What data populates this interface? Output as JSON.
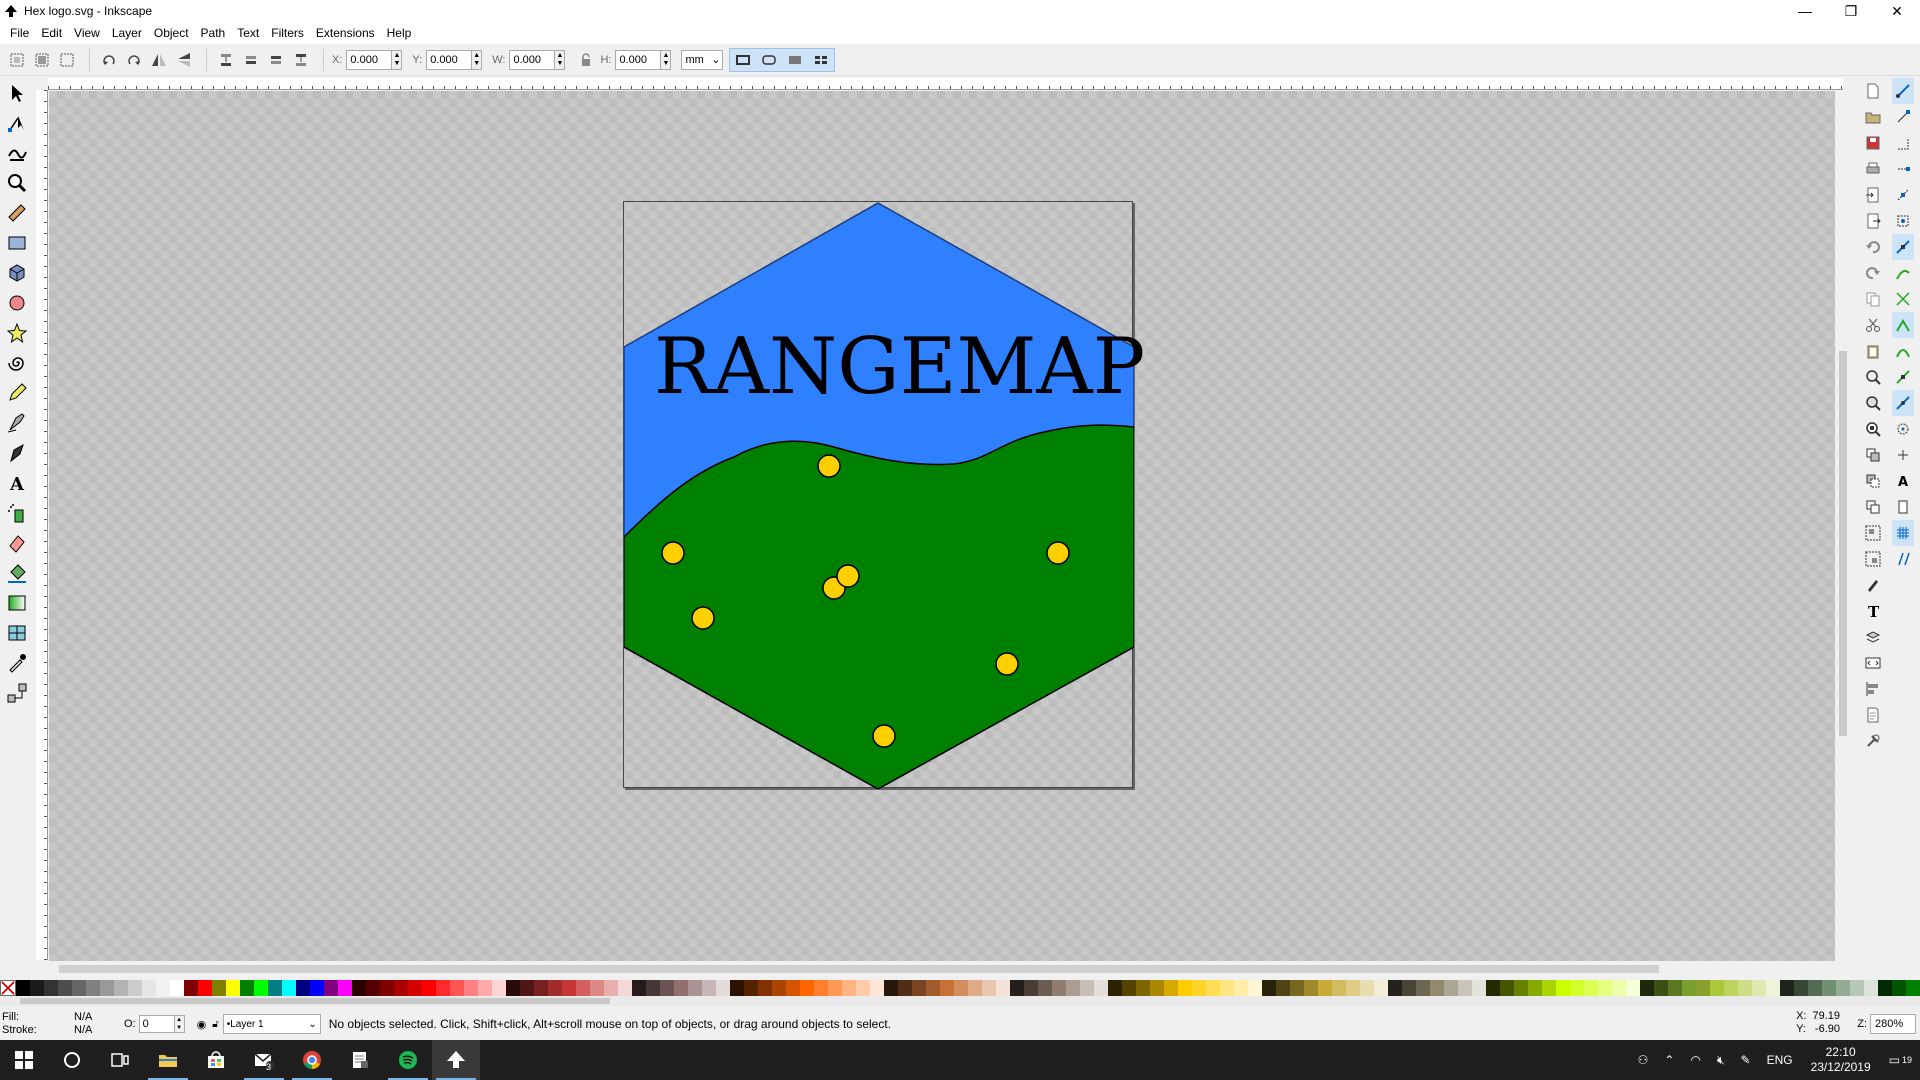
{
  "window": {
    "title": "Hex logo.svg - Inkscape",
    "minimize": "—",
    "maximize": "❐",
    "close": "✕"
  },
  "menu": [
    "File",
    "Edit",
    "View",
    "Layer",
    "Object",
    "Path",
    "Text",
    "Filters",
    "Extensions",
    "Help"
  ],
  "controls": {
    "x_label": "X:",
    "x_value": "0.000",
    "y_label": "Y:",
    "y_value": "0.000",
    "w_label": "W:",
    "w_value": "0.000",
    "h_label": "H:",
    "h_value": "0.000",
    "unit": "mm"
  },
  "canvas": {
    "logo_text": "RANGEMAP",
    "sky_color": "#2f80ff",
    "grass_color": "#008000",
    "dot_color": "#ffd000"
  },
  "palette": [
    "#000000",
    "#1a1a1a",
    "#333333",
    "#4d4d4d",
    "#666666",
    "#808080",
    "#999999",
    "#b3b3b3",
    "#cccccc",
    "#e6e6e6",
    "#f2f2f2",
    "#ffffff",
    "#800000",
    "#ff0000",
    "#808000",
    "#ffff00",
    "#008000",
    "#00ff00",
    "#008080",
    "#00ffff",
    "#000080",
    "#0000ff",
    "#800080",
    "#ff00ff",
    "#2b0000",
    "#550000",
    "#800000",
    "#aa0000",
    "#d40000",
    "#ff0000",
    "#ff2a2a",
    "#ff5555",
    "#ff8080",
    "#ffaaaa",
    "#ffd5d5",
    "#280b0b",
    "#501616",
    "#782121",
    "#a02c2c",
    "#c83737",
    "#d35f5f",
    "#de8787",
    "#e9afaf",
    "#f4d7d7",
    "#241c1c",
    "#483737",
    "#6c5353",
    "#916f6f",
    "#ac9393",
    "#c8b7b7",
    "#e3dbdb",
    "#2b1100",
    "#552200",
    "#803300",
    "#aa4400",
    "#d45500",
    "#ff6600",
    "#ff7f2a",
    "#ff9955",
    "#ffb380",
    "#ffccaa",
    "#ffe6d5",
    "#28170b",
    "#502d16",
    "#784421",
    "#a05a2c",
    "#c87137",
    "#d38d5f",
    "#deaa87",
    "#e9c6af",
    "#f4e3d7",
    "#241f1c",
    "#483e37",
    "#6c5d53",
    "#917c6f",
    "#ac9d93",
    "#c8beb7",
    "#e3dedb",
    "#2b2200",
    "#554400",
    "#806600",
    "#aa8800",
    "#d4aa00",
    "#ffcc00",
    "#ffd42a",
    "#ffdd55",
    "#ffe680",
    "#ffeeaa",
    "#fff6d5",
    "#28220b",
    "#504416",
    "#786721",
    "#a0892c",
    "#c8ab37",
    "#d3bc5f",
    "#decd87",
    "#e9ddaf",
    "#f4eed7",
    "#24221c",
    "#484537",
    "#6c6753",
    "#918a6f",
    "#aca793",
    "#c8c4b7",
    "#e3e2db",
    "#222b00",
    "#445500",
    "#668000",
    "#88aa00",
    "#aad400",
    "#ccff00",
    "#d4ff2a",
    "#ddff55",
    "#e5ff80",
    "#eeffaa",
    "#f6ffd5",
    "#1e280b",
    "#3c5016",
    "#597821",
    "#78a02c",
    "#89a02c",
    "#abc837",
    "#bcd35f",
    "#cdde87",
    "#dde9af",
    "#eef4d7",
    "#1c241c",
    "#374837",
    "#536c53",
    "#6f916f",
    "#93ac93",
    "#b7c8b7",
    "#dbe3db",
    "#002b00",
    "#005500",
    "#008000"
  ],
  "status": {
    "fill_label": "Fill:",
    "fill_value": "N/A",
    "stroke_label": "Stroke:",
    "stroke_value": "N/A",
    "opacity_label": "O:",
    "opacity_value": "0",
    "layer": "•Layer 1",
    "message": "No objects selected. Click, Shift+click, Alt+scroll mouse on top of objects, or drag around objects to select.",
    "x_label": "X:",
    "y_label": "Y:",
    "x_value": "79.19",
    "y_value": "-6.90",
    "zoom_label": "Z:",
    "zoom_value": "280%"
  },
  "taskbar": {
    "language": "ENG",
    "time": "22:10",
    "date": "23/12/2019",
    "mail_badge": "3",
    "notification_count": "19"
  }
}
